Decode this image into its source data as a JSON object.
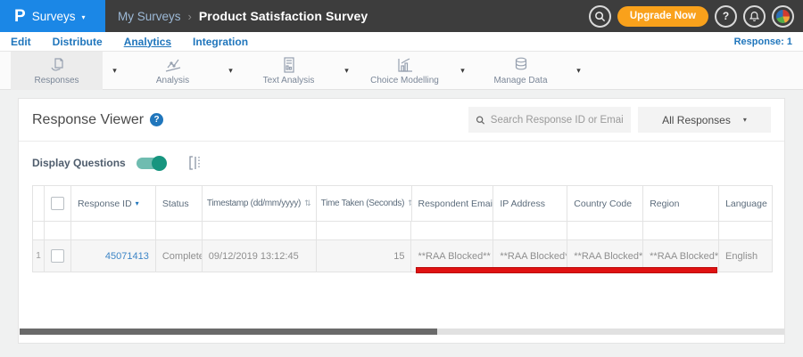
{
  "colors": {
    "brand_blue": "#1b87e6",
    "header_dark": "#3d3d3d",
    "link_blue": "#2076bc",
    "upgrade_orange": "#f9a11b",
    "toggle_teal": "#17957f",
    "annotation_red": "#e01212"
  },
  "glyphs": {
    "caret_down": "▾",
    "sort_desc": "▾",
    "sort_both": "⇅",
    "help": "?"
  },
  "header": {
    "logo_letter": "P",
    "product_menu": "Surveys",
    "breadcrumb": {
      "parent": "My Surveys",
      "separator": "›",
      "current": "Product Satisfaction Survey"
    },
    "upgrade_label": "Upgrade Now"
  },
  "nav": {
    "items": [
      {
        "label": "Edit"
      },
      {
        "label": "Distribute"
      },
      {
        "label": "Analytics"
      },
      {
        "label": "Integration"
      }
    ],
    "response_count": "Response: 1"
  },
  "toolbar": {
    "items": [
      {
        "label": "Responses"
      },
      {
        "label": "Analysis"
      },
      {
        "label": "Text Analysis"
      },
      {
        "label": "Choice Modelling"
      },
      {
        "label": "Manage Data"
      }
    ]
  },
  "panel": {
    "title": "Response Viewer",
    "search_placeholder": "Search Response ID or Email",
    "filter_selected": "All Responses",
    "display_questions_label": "Display Questions",
    "table": {
      "columns": {
        "response_id": "Response ID",
        "status": "Status",
        "timestamp": "Timestamp (dd/mm/yyyy)",
        "time_taken": "Time Taken (Seconds)",
        "email": "Respondent Email",
        "ip": "IP Address",
        "country": "Country Code",
        "region": "Region",
        "language": "Language"
      },
      "rows": [
        {
          "num": "1",
          "response_id": "45071413",
          "status": "Completed",
          "timestamp": "09/12/2019 13:12:45",
          "time_taken": "15",
          "email": "**RAA Blocked**",
          "ip": "**RAA Blocked**",
          "country": "**RAA Blocked**",
          "region": "**RAA Blocked**",
          "language": "English"
        }
      ]
    }
  }
}
